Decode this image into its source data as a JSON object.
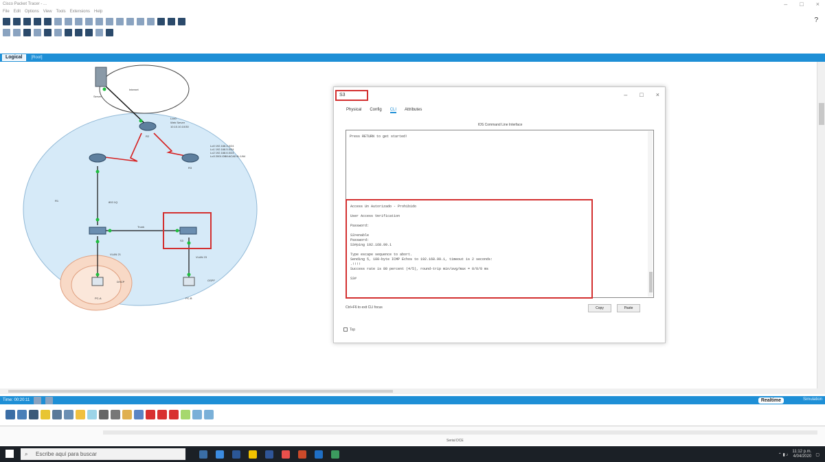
{
  "window": {
    "title": "Cisco Packet Tracer - ..."
  },
  "menu": {
    "items": [
      "File",
      "Edit",
      "Options",
      "View",
      "Tools",
      "Extensions",
      "Help"
    ]
  },
  "toolbar": {
    "help_label": "?"
  },
  "workspace": {
    "logical_tab": "Logical",
    "root_label": "[Root]"
  },
  "topology": {
    "labels": {
      "server": "Server",
      "internet": "Internet",
      "isp_note_line1": "Loc0",
      "isp_note_line2": "Web Server",
      "isp_note_line3": "10.10.10.10/30",
      "r1": "R1",
      "r2": "R2",
      "r3": "R3",
      "r3_note": "Lo0 192.168.4.0/24\nLo1 192.168.5.0/24\nLo2 192.168.6.0/24\nLo3 2001:DB8:ACAD:5::1/64",
      "link_label": "802.1Q",
      "trunk": "Trunk",
      "vlan21": "VLAN 21",
      "vlan23": "VLAN 23",
      "pc_a": "PC-A",
      "pc_b": "PC-B",
      "dhcp": "DHCP",
      "ospf": "OSPF",
      "s3": "S3"
    }
  },
  "pc_window": {
    "title": "S3",
    "tabs": [
      "Physical",
      "Config",
      "CLI",
      "Attributes"
    ],
    "active_tab": "CLI",
    "subtitle": "IOS Command Line Interface",
    "cmd_top": "Press RETURN to get started!",
    "cmd_body": "User Access Verification\n\nPassword:\n\nS3>enable\nPassword:\nS3#ping 192.168.99.1\n\nType escape sequence to abort.\nSending 5, 100-byte ICMP Echos to 192.168.99.1, timeout is 2 seconds:\n.!!!!\nSuccess rate is 80 percent (4/5), round-trip min/avg/max = 0/0/0 ms\n\nS3#",
    "cmd_first_line": "Access Un Autorizado - Prohibido",
    "footer_left": "Ctrl+F6 to exit CLI focus",
    "copy_label": "Copy",
    "paste_label": "Paste",
    "top_label": "Top"
  },
  "bottombar": {
    "time_label": "Time: 00:20:11",
    "realtime_label": "Realtime",
    "simulation_label": "Simulation"
  },
  "lower_strip": {
    "scenario_label": "Serial DCE"
  },
  "taskbar": {
    "search_placeholder": "Escribe aquí para buscar",
    "clock_time": "11:12 p.m.",
    "clock_date": "4/04/2020"
  }
}
